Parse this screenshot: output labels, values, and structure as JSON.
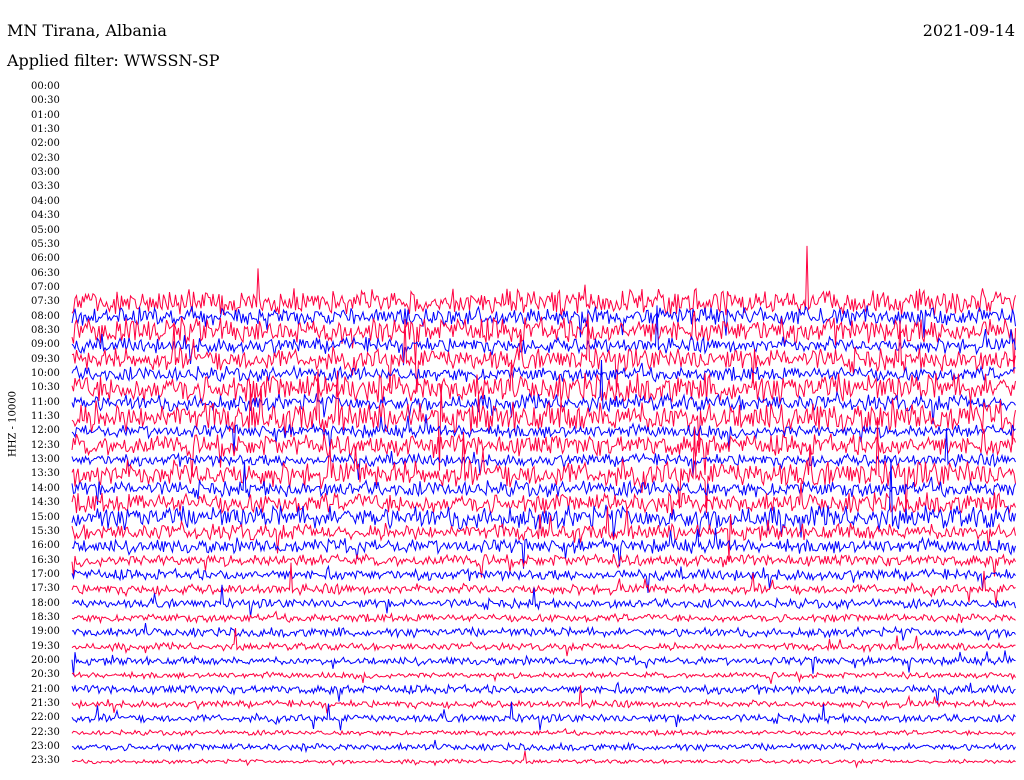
{
  "header": {
    "station": "MN Tirana, Albania",
    "date": "2021-09-14",
    "filter": "Applied filter: WWSSN-SP"
  },
  "chart_data": {
    "type": "line",
    "title": "MN Tirana, Albania",
    "ylabel": "HHZ - 10000",
    "ytick_labels": [
      "00:00",
      "00:30",
      "01:00",
      "01:30",
      "02:00",
      "02:30",
      "03:00",
      "03:30",
      "04:00",
      "04:30",
      "05:00",
      "05:30",
      "06:00",
      "06:30",
      "07:00",
      "07:30",
      "08:00",
      "08:30",
      "09:00",
      "09:30",
      "10:00",
      "10:30",
      "11:00",
      "11:30",
      "12:00",
      "12:30",
      "13:00",
      "13:30",
      "14:00",
      "14:30",
      "15:00",
      "15:30",
      "16:00",
      "16:30",
      "17:00",
      "17:30",
      "18:00",
      "18:30",
      "19:00",
      "19:30",
      "20:00",
      "20:30",
      "21:00",
      "21:30",
      "22:00",
      "22:30",
      "23:00",
      "23:30"
    ],
    "trace_colors": [
      "#ff0040",
      "#0000ff"
    ],
    "first_trace_start": "07:30",
    "trace_amplitude_relative": [
      2.4,
      1.8,
      2.6,
      1.5,
      2.2,
      1.4,
      2.8,
      1.6,
      3.0,
      1.3,
      2.2,
      1.2,
      2.6,
      1.5,
      2.0,
      2.2,
      1.6,
      1.4,
      1.2,
      1.1,
      1.0,
      0.9,
      0.8,
      0.9,
      0.7,
      0.8,
      0.6,
      0.9,
      0.7,
      0.8,
      0.5,
      0.7,
      0.4,
      0.6
    ],
    "grid": false,
    "legend": "none"
  }
}
